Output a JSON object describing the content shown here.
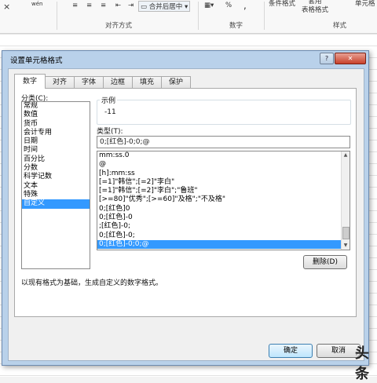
{
  "ribbon": {
    "font_ctrl": "wén",
    "cross_icon": "×",
    "merge_label": "合并后居中",
    "percent": "%",
    "comma": ",",
    "cond_format_label": "条件格式",
    "table_format_label": "套用\n表格格式",
    "cell_style_label": "单元格",
    "groups": {
      "align": "对齐方式",
      "number": "数字",
      "style": "样式"
    }
  },
  "dialog": {
    "title": "设置单元格格式",
    "help_btn": "?",
    "close_btn": "✕",
    "tabs": [
      "数字",
      "对齐",
      "字体",
      "边框",
      "填充",
      "保护"
    ],
    "category_label": "分类(C):",
    "categories": [
      "常规",
      "数值",
      "货币",
      "会计专用",
      "日期",
      "时间",
      "百分比",
      "分数",
      "科学记数",
      "文本",
      "特殊",
      "自定义"
    ],
    "selected_category": "自定义",
    "sample_label": "示例",
    "sample_value": "-11",
    "type_label": "类型(T):",
    "type_value": "0;[红色]-0;0;@",
    "formats": [
      "mm:ss.0",
      "@",
      "[h]:mm:ss",
      "[=1]\"韩信\";[=2]\"李白\"",
      "[=1]\"韩信\";[=2]\"李白\";\"鲁班\"",
      "[>=80]\"优秀\";[>=60]\"及格\";\"不及格\"",
      "0;[红色]0",
      "0;[红色]-0",
      ";[红色]-0;",
      "0;[红色]-0;",
      "0;[红色]-0;0;@"
    ],
    "selected_format": "0;[红色]-0;0;@",
    "delete_btn": "删除(D)",
    "description": "以现有格式为基础，生成自定义的数字格式。",
    "ok_btn": "确定",
    "cancel_btn": "取消"
  },
  "watermark": "头条"
}
